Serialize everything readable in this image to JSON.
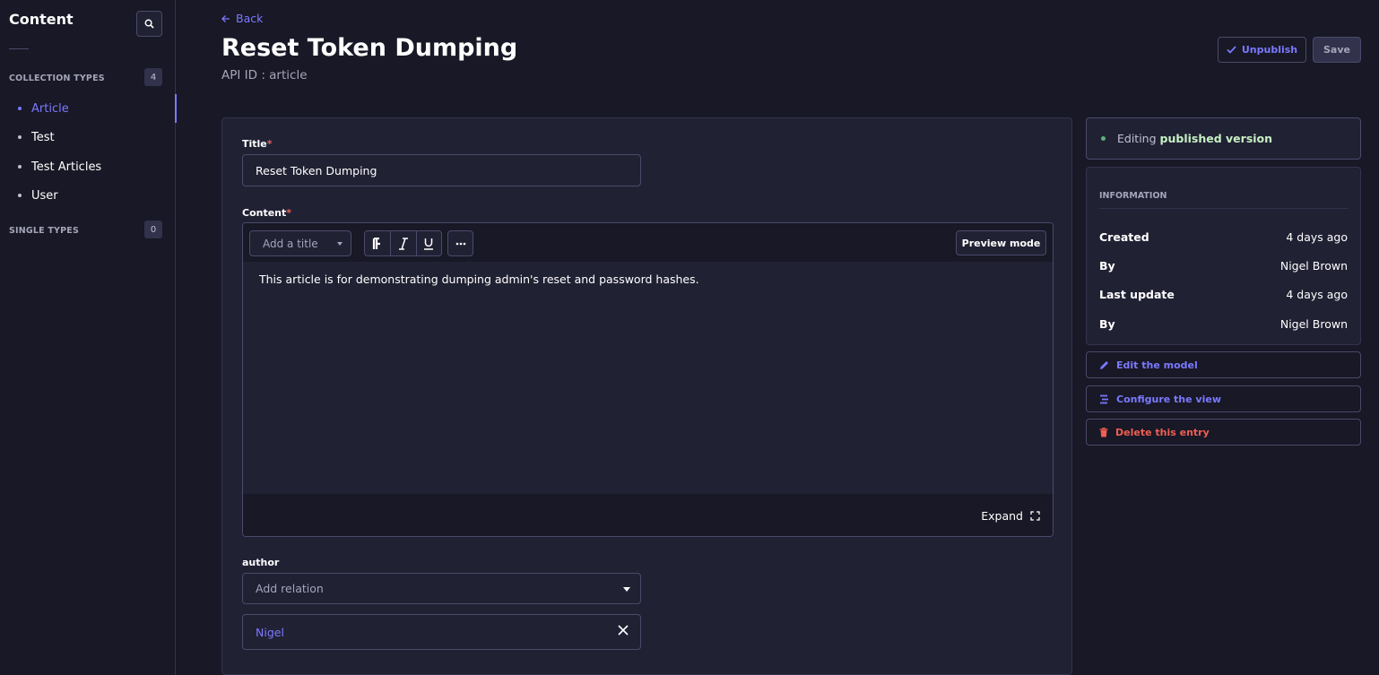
{
  "sidebar": {
    "title": "Content",
    "collection_types": {
      "label": "COLLECTION TYPES",
      "count": "4"
    },
    "items": [
      {
        "label": "Article"
      },
      {
        "label": "Test"
      },
      {
        "label": "Test Articles"
      },
      {
        "label": "User"
      }
    ],
    "single_types": {
      "label": "SINGLE TYPES",
      "count": "0"
    }
  },
  "header": {
    "back_label": "Back",
    "title": "Reset Token Dumping",
    "api_id": "API ID : article",
    "unpublish_label": "Unpublish",
    "save_label": "Save"
  },
  "form": {
    "title_label": "Title",
    "title_value": "Reset Token Dumping",
    "content_label": "Content",
    "heading_placeholder": "Add a title",
    "preview_label": "Preview mode",
    "content_text": "This article is for demonstrating dumping admin's reset and password hashes.",
    "expand_label": "Expand",
    "author_label": "author",
    "relation_placeholder": "Add relation",
    "relation_value": "Nigel"
  },
  "side": {
    "status_prefix": "Editing",
    "status_bold": "published version",
    "info_heading": "INFORMATION",
    "rows": [
      {
        "key": "Created",
        "value": "4 days ago"
      },
      {
        "key": "By",
        "value": "Nigel Brown"
      },
      {
        "key": "Last update",
        "value": "4 days ago"
      },
      {
        "key": "By",
        "value": "Nigel Brown"
      }
    ],
    "edit_model": "Edit the model",
    "configure_view": "Configure the view",
    "delete_entry": "Delete this entry"
  },
  "colors": {
    "accent": "#7b79ff",
    "danger": "#ee5e52",
    "success": "#5cb176",
    "background": "#181826",
    "surface": "#212134"
  }
}
